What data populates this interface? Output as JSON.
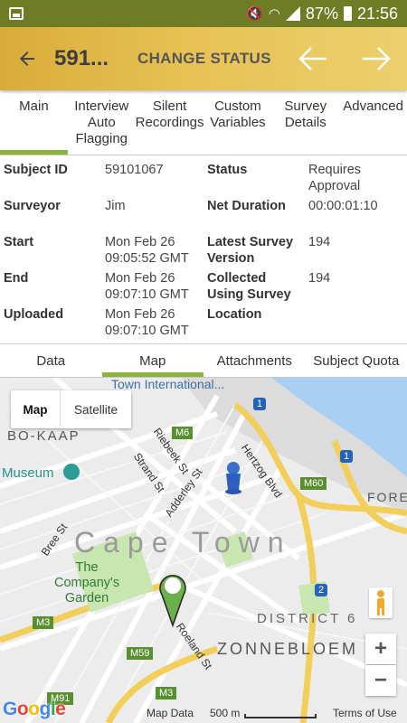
{
  "status_bar": {
    "battery": "87%",
    "time": "21:56"
  },
  "app_bar": {
    "title": "591...",
    "change_status": "CHANGE STATUS"
  },
  "tabs_top": [
    {
      "label": "Main",
      "active": true
    },
    {
      "label": "Interview\nAuto\nFlagging",
      "active": false
    },
    {
      "label": "Silent\nRecordings",
      "active": false
    },
    {
      "label": "Custom\nVariables",
      "active": false
    },
    {
      "label": "Survey\nDetails",
      "active": false
    },
    {
      "label": "Advanced",
      "active": false
    }
  ],
  "info": {
    "subject_id_label": "Subject ID",
    "subject_id": "59101067",
    "status_label": "Status",
    "status": "Requires\nApproval",
    "surveyor_label": "Surveyor",
    "surveyor": "Jim",
    "net_duration_label": "Net Duration",
    "net_duration": "00:00:01:10",
    "start_label": "Start",
    "start": "Mon Feb 26\n09:05:52 GMT",
    "latest_version_label": "Latest Survey\nVersion",
    "latest_version": "194",
    "end_label": "End",
    "end": "Mon Feb 26\n09:07:10 GMT",
    "collected_label": "Collected\nUsing Survey",
    "collected": "194",
    "uploaded_label": "Uploaded",
    "uploaded": "Mon Feb 26\n09:07:10 GMT",
    "location_label": "Location"
  },
  "tabs_bottom": [
    {
      "label": "Data",
      "active": false
    },
    {
      "label": "Map",
      "active": true
    },
    {
      "label": "Attachments",
      "active": false
    },
    {
      "label": "Subject Quota",
      "active": false
    }
  ],
  "map": {
    "type_map": "Map",
    "type_satellite": "Satellite",
    "labels": {
      "town_international": "Town International...",
      "bo_kaap": "BO-KAAP",
      "museum": "Museum",
      "riebeek": "Riebeek St",
      "strand": "Strand St",
      "adderley": "Adderley St",
      "hertzog": "Hertzog Blvd",
      "bree": "Bree St",
      "cape_town": "Cape Town",
      "company_garden": "The\nCompany's\nGarden",
      "roeland": "Roeland St",
      "district6": "DISTRICT 6",
      "zonnebloem": "ZONNEBLOEM",
      "fore": "FORE",
      "m6": "M6",
      "m60": "M60",
      "m3": "M3",
      "m59": "M59",
      "m91": "M91",
      "n1": "1",
      "n2": "2"
    },
    "zoom_in": "+",
    "zoom_out": "−",
    "google": "Google",
    "map_data": "Map Data",
    "scale": "500 m",
    "terms": "Terms of Use"
  }
}
